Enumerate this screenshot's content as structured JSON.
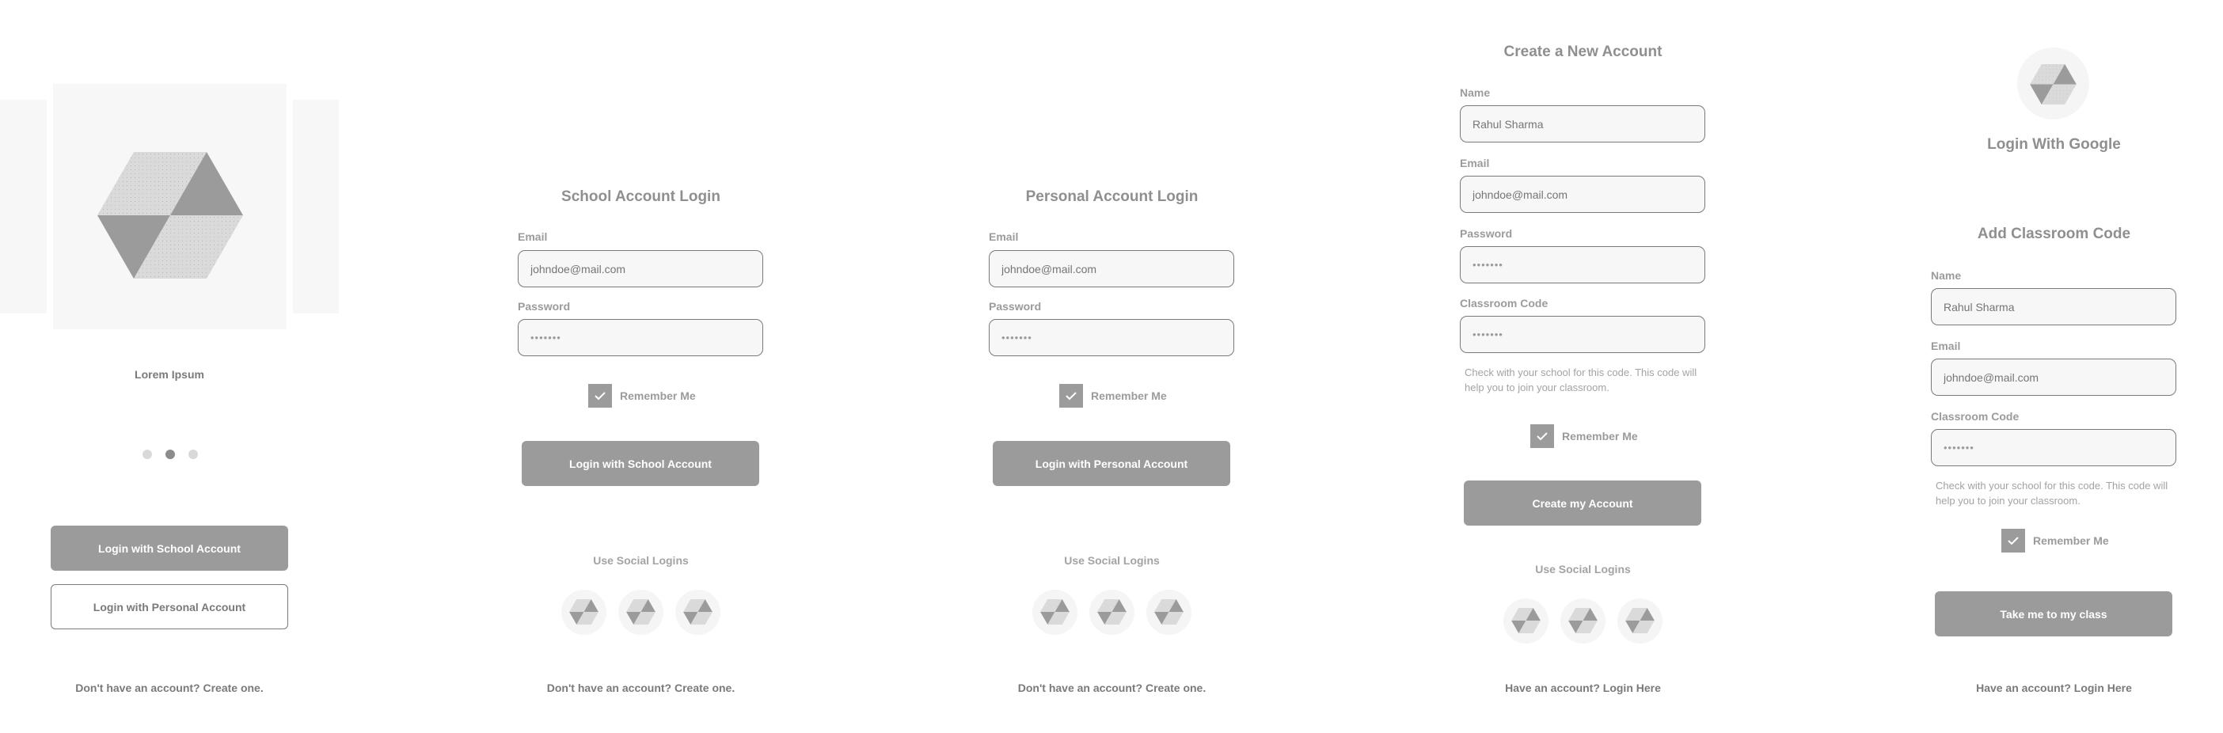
{
  "colors": {
    "primary_button": "#9b9b9b",
    "text_muted": "#9b9b9b",
    "text_dark": "#7a7a7a",
    "input_bg": "#f7f7f7",
    "input_border": "#7a7a7a",
    "dot_inactive": "#d9d9d9",
    "dot_active": "#8c8c8c"
  },
  "onboarding": {
    "carousel_caption": "Lorem Ipsum",
    "carousel_icon": "hexagon-placeholder-icon",
    "carousel_dots": 3,
    "active_dot": 2,
    "school_button": "Login with School Account",
    "personal_button": "Login with Personal Account",
    "footer": "Don't have an account? Create one."
  },
  "school_login": {
    "title": "School Account Login",
    "email_label": "Email",
    "email_placeholder": "johndoe@mail.com",
    "password_label": "Password",
    "password_value": "•••••••",
    "remember_label": "Remember Me",
    "remember_checked": true,
    "submit": "Login with School Account",
    "social_label": "Use Social Logins",
    "social_icons": [
      "social-login-icon",
      "social-login-icon",
      "social-login-icon"
    ],
    "footer": "Don't have an account? Create one."
  },
  "personal_login": {
    "title": "Personal Account Login",
    "email_label": "Email",
    "email_placeholder": "johndoe@mail.com",
    "password_label": "Password",
    "password_value": "•••••••",
    "remember_label": "Remember Me",
    "remember_checked": true,
    "submit": "Login with Personal Account",
    "social_label": "Use Social Logins",
    "social_icons": [
      "social-login-icon",
      "social-login-icon",
      "social-login-icon"
    ],
    "footer": "Don't have an account? Create one."
  },
  "create_account": {
    "title": "Create a New Account",
    "name_label": "Name",
    "name_placeholder": "Rahul Sharma",
    "email_label": "Email",
    "email_placeholder": "johndoe@mail.com",
    "password_label": "Password",
    "password_value": "•••••••",
    "code_label": "Classroom Code",
    "code_value": "•••••••",
    "help_text": "Check with your school for this code. This code will help you to join your classroom.",
    "remember_label": "Remember Me",
    "remember_checked": true,
    "submit": "Create my Account",
    "social_label": "Use Social Logins",
    "social_icons": [
      "social-login-icon",
      "social-login-icon",
      "social-login-icon"
    ],
    "footer": "Have an account? Login Here"
  },
  "classroom_code": {
    "google_label": "Login With Google",
    "title": "Add Classroom Code",
    "name_label": "Name",
    "name_placeholder": "Rahul Sharma",
    "email_label": "Email",
    "email_placeholder": "johndoe@mail.com",
    "code_label": "Classroom Code",
    "code_value": "•••••••",
    "help_text": "Check with your school for this code. This code will help you to join your classroom.",
    "remember_label": "Remember Me",
    "remember_checked": true,
    "submit": "Take me to my class",
    "footer": "Have an account? Login Here"
  }
}
